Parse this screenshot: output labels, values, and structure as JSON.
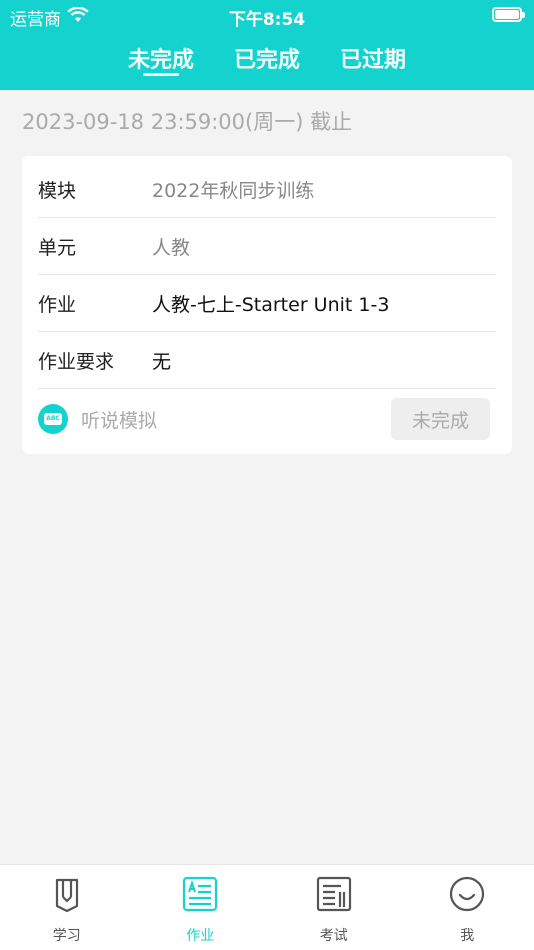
{
  "status_bar": {
    "carrier": "运营商",
    "time": "下午8:54"
  },
  "tabs": [
    {
      "label": "未完成",
      "active": true
    },
    {
      "label": "已完成",
      "active": false
    },
    {
      "label": "已过期",
      "active": false
    }
  ],
  "deadline": "2023-09-18 23:59:00(周一) 截止",
  "card": {
    "rows": [
      {
        "label": "模块",
        "value": "2022年秋同步训练"
      },
      {
        "label": "单元",
        "value": "人教"
      },
      {
        "label": "作业",
        "value": "人教-七上-Starter Unit 1-3"
      },
      {
        "label": "作业要求",
        "value": "无"
      }
    ],
    "footer": {
      "icon_text": "ABC",
      "type_label": "听说模拟",
      "status_button": "未完成"
    }
  },
  "tabbar": [
    {
      "label": "学习",
      "icon": "book-icon"
    },
    {
      "label": "作业",
      "icon": "homework-icon",
      "active": true
    },
    {
      "label": "考试",
      "icon": "exam-icon"
    },
    {
      "label": "我",
      "icon": "smile-icon"
    }
  ],
  "colors": {
    "accent": "#14d3cf",
    "background": "#f3f3f3"
  }
}
